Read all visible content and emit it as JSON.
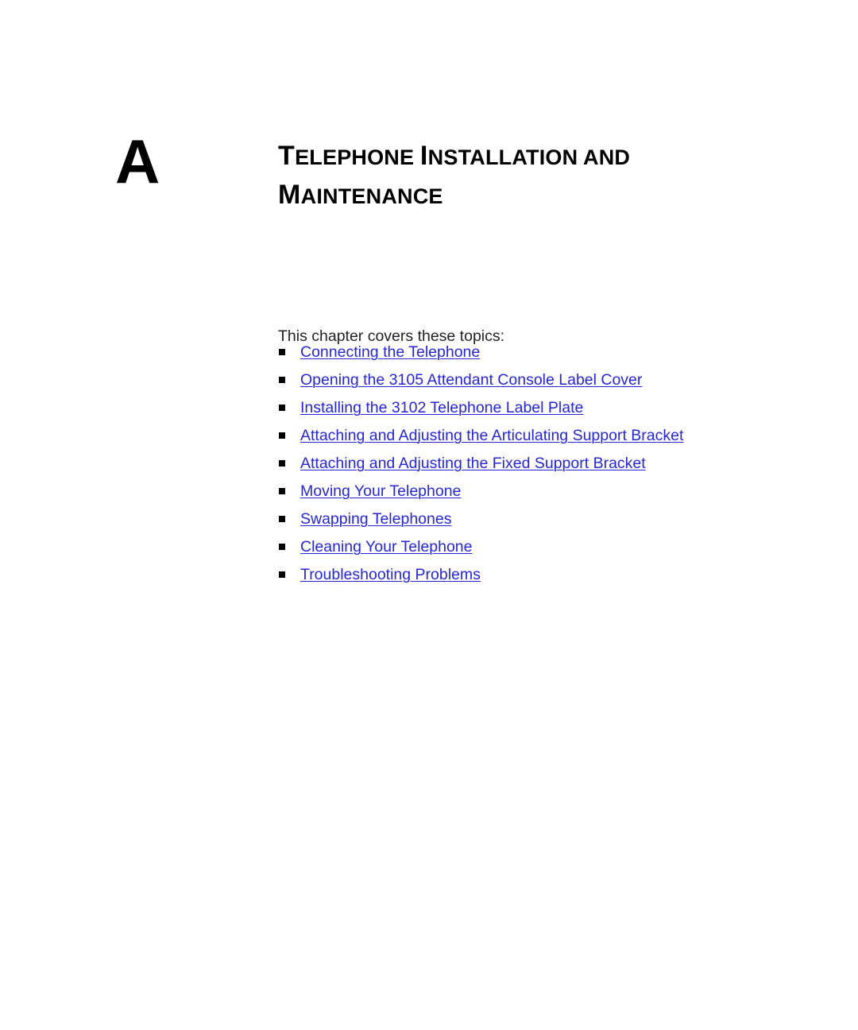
{
  "page": {
    "background_color": "#FFFFFF",
    "text_color": "#231F20",
    "link_color": "#2626D6",
    "bullet_color": "#000000"
  },
  "chapter": {
    "letter": "A",
    "title_line_1_cap": "T",
    "title_line_1_rest": "ELEPHONE ",
    "title_line_1_cap_2": "I",
    "title_line_1_rest_2": "NSTALLATION AND",
    "title_line_2_cap": "M",
    "title_line_2_rest": "AINTENANCE",
    "title_full": "Telephone Installation and Maintenance"
  },
  "intro": {
    "text": "This chapter covers these topics:"
  },
  "topics": {
    "bullet_glyph": "square",
    "items": [
      {
        "label": "Connecting the Telephone"
      },
      {
        "label": "Opening the 3105 Attendant Console Label Cover"
      },
      {
        "label": "Installing the 3102 Telephone Label Plate"
      },
      {
        "label": "Attaching and Adjusting the Articulating Support Bracket"
      },
      {
        "label": "Attaching and Adjusting the Fixed Support Bracket"
      },
      {
        "label": "Moving Your Telephone"
      },
      {
        "label": "Swapping Telephones"
      },
      {
        "label": "Cleaning Your Telephone"
      },
      {
        "label": "Troubleshooting Problems"
      }
    ]
  }
}
